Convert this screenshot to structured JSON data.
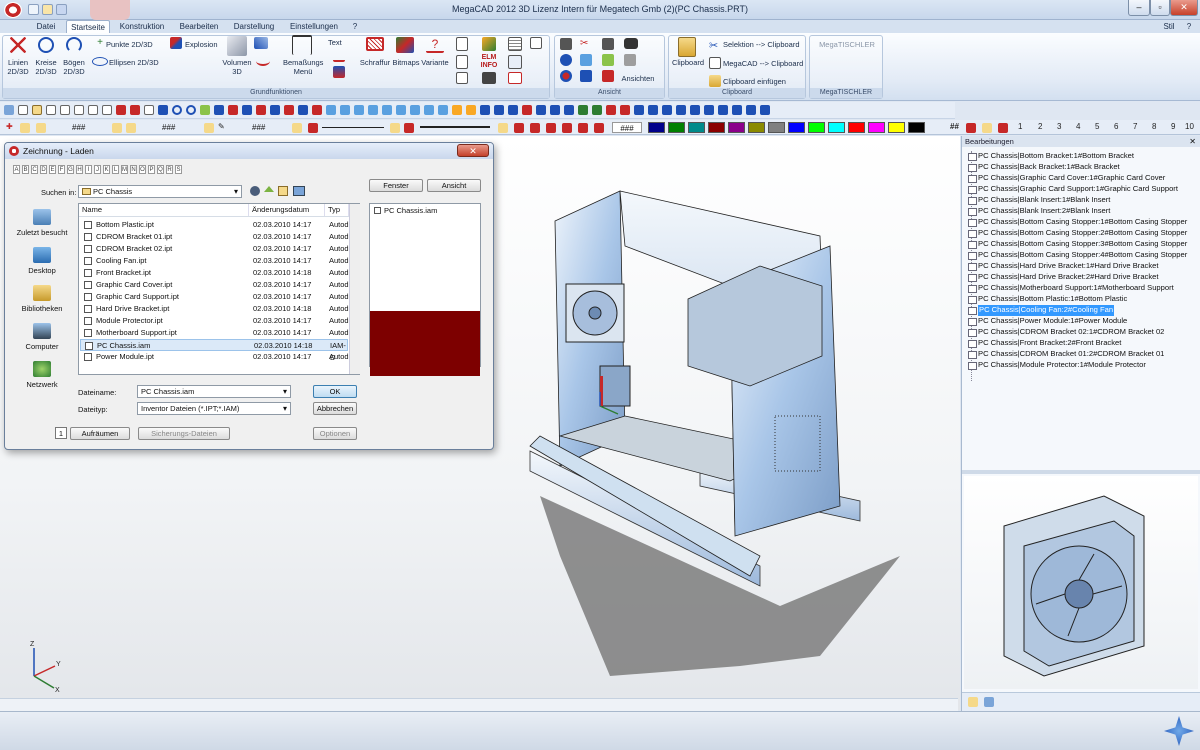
{
  "window": {
    "title": "MegaCAD 2012 3D  Lizenz Intern für Megatech Gmb (2)(PC Chassis.PRT)",
    "style_label": "Stil"
  },
  "tabs": [
    "Datei",
    "Startseite",
    "Konstruktion",
    "Bearbeiten",
    "Darstellung",
    "Einstellungen",
    "?"
  ],
  "ribbon": {
    "grundfunktionen": {
      "label": "Grundfunktionen",
      "linien": "Linien",
      "linien_sub": "2D/3D",
      "kreise": "Kreise",
      "kreise_sub": "2D/3D",
      "boegen": "Bögen",
      "boegen_sub": "2D/3D",
      "punkte": "Punkte 2D/3D",
      "ellipsen": "Ellipsen 2D/3D",
      "explosion": "Explosion",
      "volumen": "Volumen",
      "volumen_sub": "3D",
      "bemassungs": "Bemaßungs",
      "bemassungs_sub": "Menü",
      "text": "Text",
      "schraffur": "Schraffur",
      "bitmaps": "Bitmaps",
      "variante": "Variante",
      "elm_info": "ELM INFO"
    },
    "ansicht": {
      "label": "Ansicht",
      "ansichten": "Ansichten"
    },
    "clipboard": {
      "label": "Clipboard",
      "clipboard_btn": "Clipboard",
      "selektion": "Selektion --> Clipboard",
      "megacad": "MegaCAD --> Clipboard",
      "einfuegen": "Clipboard einfügen"
    },
    "megatischler": {
      "label": "MegaTISCHLER",
      "title": "MegaTISCHLER"
    }
  },
  "toolbar2": {
    "hash": "###",
    "numbers": [
      "1",
      "2",
      "3",
      "4",
      "5",
      "6",
      "7",
      "8",
      "9",
      "10"
    ],
    "double_hash": "##",
    "colors": [
      "#00008b",
      "#008000",
      "#008b8b",
      "#8b0000",
      "#8b008b",
      "#8b8b00",
      "#808080",
      "#0000ff",
      "#00ff00",
      "#00ffff",
      "#ff0000",
      "#ff00ff",
      "#ffff00",
      "#000000"
    ]
  },
  "right_panel": {
    "title": "Bearbeitungen",
    "items": [
      "PC Chassis|Bottom Bracket:1#Bottom Bracket",
      "PC Chassis|Back Bracket:1#Back Bracket",
      "PC Chassis|Graphic Card Cover:1#Graphic Card Cover",
      "PC Chassis|Graphic Card Support:1#Graphic Card Support",
      "PC Chassis|Blank Insert:1#Blank Insert",
      "PC Chassis|Blank Insert:2#Blank Insert",
      "PC Chassis|Bottom Casing Stopper:1#Bottom Casing Stopper",
      "PC Chassis|Bottom Casing Stopper:2#Bottom Casing Stopper",
      "PC Chassis|Bottom Casing Stopper:3#Bottom Casing Stopper",
      "PC Chassis|Bottom Casing Stopper:4#Bottom Casing Stopper",
      "PC Chassis|Hard Drive Bracket:1#Hard Drive Bracket",
      "PC Chassis|Hard Drive Bracket:2#Hard Drive Bracket",
      "PC Chassis|Motherboard Support:1#Motherboard Support",
      "PC Chassis|Bottom Plastic:1#Bottom Plastic",
      "PC Chassis|Cooling Fan:2#Cooling Fan",
      "PC Chassis|Power Module:1#Power Module",
      "PC Chassis|CDROM Bracket 02:1#CDROM Bracket 02",
      "PC Chassis|Front Bracket:2#Front Bracket",
      "PC Chassis|CDROM Bracket 01:2#CDROM Bracket 01",
      "PC Chassis|Module Protector:1#Module Protector"
    ],
    "selected_index": 14
  },
  "dialog": {
    "title": "Zeichnung - Laden",
    "letters": [
      "A",
      "B",
      "C",
      "D",
      "E",
      "F",
      "G",
      "H",
      "I",
      "J",
      "K",
      "L",
      "M",
      "N",
      "O",
      "P",
      "Q",
      "R",
      "S"
    ],
    "fenster": "Fenster",
    "ansicht": "Ansicht",
    "suchen_in_label": "Suchen in:",
    "suchen_in_value": "PC Chassis",
    "places": [
      "Zuletzt besucht",
      "Desktop",
      "Bibliotheken",
      "Computer",
      "Netzwerk"
    ],
    "columns": {
      "name": "Name",
      "date": "Änderungsdatum",
      "type": "Typ"
    },
    "files": [
      {
        "name": "Bottom Plastic.ipt",
        "date": "02.03.2010 14:17",
        "type": "Autode"
      },
      {
        "name": "CDROM Bracket 01.ipt",
        "date": "02.03.2010 14:17",
        "type": "Autode"
      },
      {
        "name": "CDROM Bracket 02.ipt",
        "date": "02.03.2010 14:17",
        "type": "Autode"
      },
      {
        "name": "Cooling Fan.ipt",
        "date": "02.03.2010 14:17",
        "type": "Autode"
      },
      {
        "name": "Front Bracket.ipt",
        "date": "02.03.2010 14:18",
        "type": "Autode"
      },
      {
        "name": "Graphic Card Cover.ipt",
        "date": "02.03.2010 14:17",
        "type": "Autode"
      },
      {
        "name": "Graphic Card Support.ipt",
        "date": "02.03.2010 14:17",
        "type": "Autode"
      },
      {
        "name": "Hard Drive Bracket.ipt",
        "date": "02.03.2010 14:18",
        "type": "Autode"
      },
      {
        "name": "Module Protector.ipt",
        "date": "02.03.2010 14:17",
        "type": "Autode"
      },
      {
        "name": "Motherboard Support.ipt",
        "date": "02.03.2010 14:17",
        "type": "Autode"
      },
      {
        "name": "PC Chassis.iam",
        "date": "02.03.2010 14:18",
        "type": "IAM-D"
      },
      {
        "name": "Power Module.ipt",
        "date": "02.03.2010 14:17",
        "type": "Autode"
      }
    ],
    "selected_file_index": 10,
    "preview_file": "PC Chassis.iam",
    "preview_color": "#7d0000",
    "dateiname_label": "Dateiname:",
    "dateiname_value": "PC Chassis.iam",
    "dateityp_label": "Dateityp:",
    "dateityp_value": "Inventor Dateien (*.IPT;*.IAM)",
    "ok": "OK",
    "abbrechen": "Abbrechen",
    "counter": "1",
    "aufraeumen": "Aufräumen",
    "sicherungs": "Sicherungs-Dateien",
    "optionen": "Optionen"
  },
  "axes": {
    "x": "X",
    "y": "Y",
    "z": "Z"
  }
}
